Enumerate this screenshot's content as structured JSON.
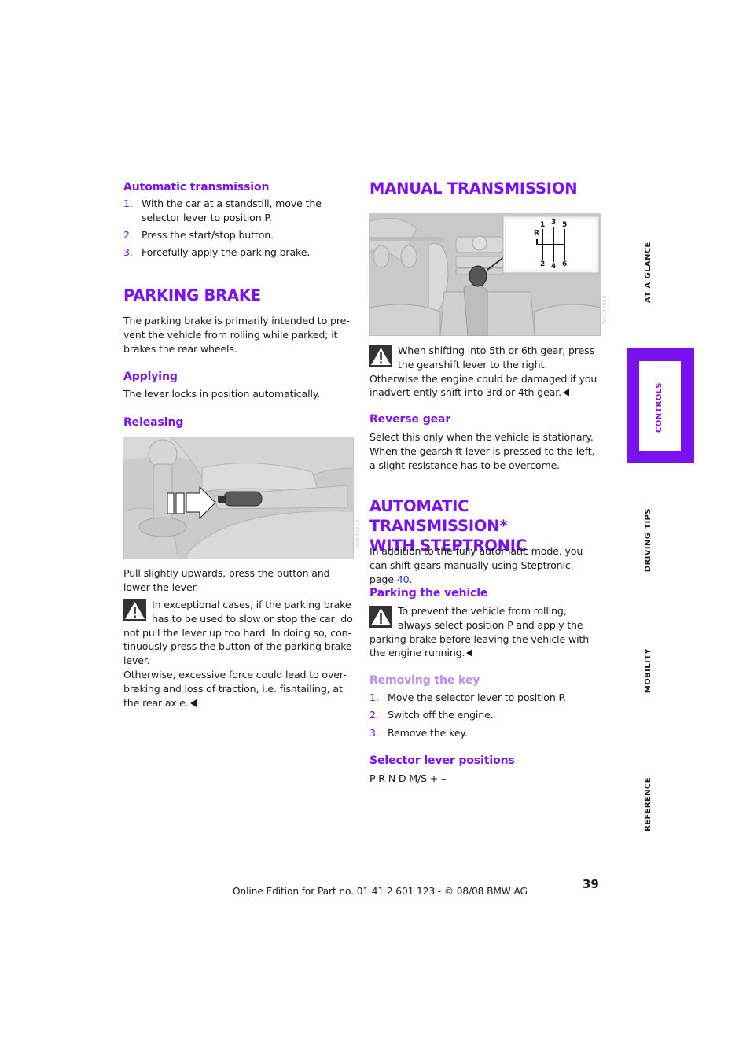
{
  "left_column": {
    "auto_transmission": {
      "heading": "Automatic transmission",
      "steps": [
        {
          "num": "1.",
          "text": "With the car at a standstill, move the selector lever to position P."
        },
        {
          "num": "2.",
          "text": "Press the start/stop button."
        },
        {
          "num": "3.",
          "text": "Forcefully apply the parking brake."
        }
      ]
    },
    "parking_brake": {
      "heading": "PARKING BRAKE",
      "intro": "The parking brake is primarily intended to pre-vent the vehicle from rolling while parked; it brakes the rear wheels.",
      "applying_heading": "Applying",
      "applying_text": "The lever locks in position automatically.",
      "releasing_heading": "Releasing",
      "figure_code": "W0C4V014",
      "figure_caption": "Pull slightly upwards, press the button and lower the lever.",
      "warning_text_1": "In exceptional cases, if the parking brake has to be used to slow or stop the car, do not pull the lever up too hard. In doing so, con-tinuously press the button of the parking brake lever.",
      "warning_text_2": "Otherwise, excessive force could lead to over-braking and loss of traction, i.e. fishtailing, at the rear axle."
    }
  },
  "right_column": {
    "manual_transmission": {
      "heading": "MANUAL TRANSMISSION",
      "figure_code": "W0C4V018",
      "shift_pattern": {
        "reverse": "R",
        "gears": [
          "1",
          "2",
          "3",
          "4",
          "5",
          "6"
        ]
      },
      "warning_text": "When shifting into 5th or 6th gear, press the gearshift lever to the right. Otherwise the engine could be damaged if you inadvert-ently shift into 3rd or 4th gear.",
      "reverse_heading": "Reverse gear",
      "reverse_text": "Select this only when the vehicle is stationary. When the gearshift lever is pressed to the left, a slight resistance has to be overcome."
    },
    "steptronic": {
      "heading_line1": "AUTOMATIC TRANSMISSION*",
      "heading_line2": "WITH STEPTRONIC",
      "intro": "In addition to the fully automatic mode, you can shift gears manually using Steptronic, page ",
      "page_link": "40",
      "intro_end": ".",
      "parking_heading": "Parking the vehicle",
      "parking_warning": "To prevent the vehicle from rolling, always select position P and apply the parking brake before leaving the vehicle with the engine running.",
      "removing_key_heading": "Removing the key",
      "removing_key_steps": [
        {
          "num": "1.",
          "text": "Move the selector lever to position P."
        },
        {
          "num": "2.",
          "text": "Switch off the engine."
        },
        {
          "num": "3.",
          "text": "Remove the key."
        }
      ],
      "selector_heading": "Selector lever positions",
      "selector_text": "P R N D M/S + –"
    }
  },
  "side_tabs": [
    {
      "label": "AT A GLANCE",
      "active": false
    },
    {
      "label": "CONTROLS",
      "active": true
    },
    {
      "label": "DRIVING TIPS",
      "active": false
    },
    {
      "label": "MOBILITY",
      "active": false
    },
    {
      "label": "REFERENCE",
      "active": false
    }
  ],
  "footer": {
    "text": "Online Edition for Part no. 01 41 2 601 123  - © 08/08 BMW AG",
    "page_number": "39"
  },
  "colors": {
    "accent": "#7a12f0",
    "accent_light": "#b98cf3",
    "link": "#1f2fd0"
  }
}
